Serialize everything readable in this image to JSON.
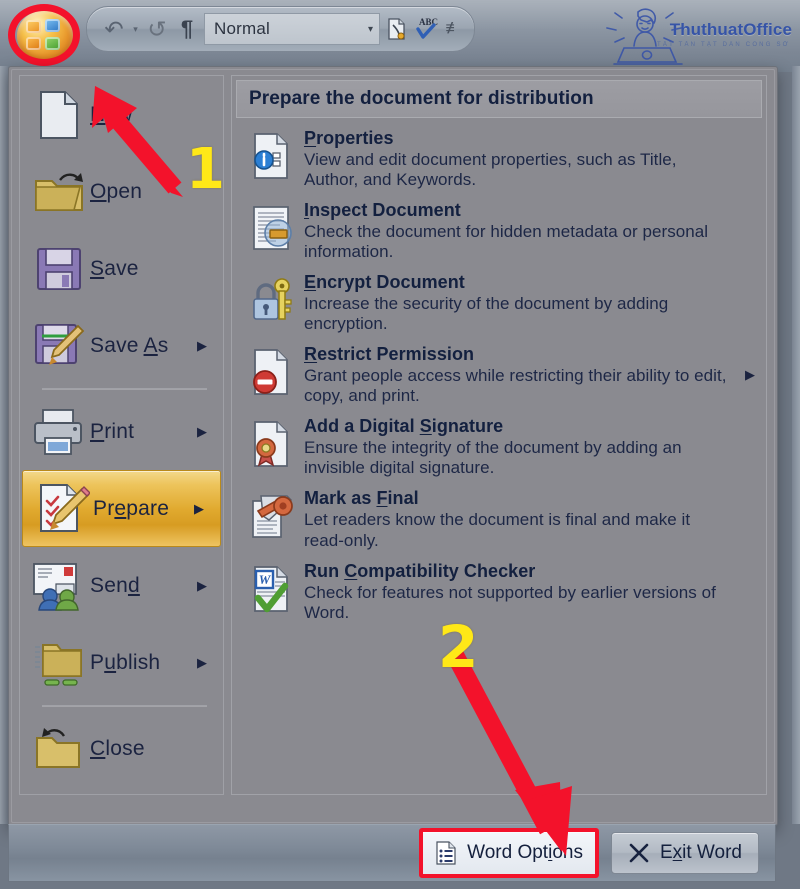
{
  "window": {
    "quick_access": {
      "undo_label": "Undo",
      "undo_dropdown": "▾",
      "redo_label": "Redo",
      "pilcrow_glyph": "¶",
      "style_value": "Normal",
      "style_caret": "▾",
      "print_preview_label": "Print Preview",
      "spelling_label": "Spelling & Grammar",
      "customize_glyph": "⩸"
    },
    "office_button_label": "Office Button",
    "watermark": {
      "brand": "ThuthuatOffice",
      "tagline": "TẤT TẦN TẬT DÂN CÔNG SỞ"
    }
  },
  "left_menu": {
    "items": [
      {
        "label": "New",
        "accel_prefix": "",
        "accel": "N",
        "accel_suffix": "ew",
        "icon": "new-document-icon",
        "has_submenu": false,
        "selected": false,
        "separator_after": false
      },
      {
        "label": "Open",
        "accel_prefix": "",
        "accel": "O",
        "accel_suffix": "pen",
        "icon": "open-folder-icon",
        "has_submenu": false,
        "selected": false,
        "separator_after": false
      },
      {
        "label": "Save",
        "accel_prefix": "",
        "accel": "S",
        "accel_suffix": "ave",
        "icon": "floppy-disk-icon",
        "has_submenu": false,
        "selected": false,
        "separator_after": false
      },
      {
        "label": "Save As",
        "accel_prefix": "Save ",
        "accel": "A",
        "accel_suffix": "s",
        "icon": "save-as-icon",
        "has_submenu": true,
        "selected": false,
        "separator_after": true
      },
      {
        "label": "Print",
        "accel_prefix": "",
        "accel": "P",
        "accel_suffix": "rint",
        "icon": "printer-icon",
        "has_submenu": true,
        "selected": false,
        "separator_after": false
      },
      {
        "label": "Prepare",
        "accel_prefix": "Pr",
        "accel": "e",
        "accel_suffix": "pare",
        "icon": "prepare-pencil-icon",
        "has_submenu": true,
        "selected": true,
        "separator_after": false
      },
      {
        "label": "Send",
        "accel_prefix": "Sen",
        "accel": "d",
        "accel_suffix": "",
        "icon": "send-envelope-icon",
        "has_submenu": true,
        "selected": false,
        "separator_after": false
      },
      {
        "label": "Publish",
        "accel_prefix": "P",
        "accel": "u",
        "accel_suffix": "blish",
        "icon": "publish-server-icon",
        "has_submenu": true,
        "selected": false,
        "separator_after": true
      },
      {
        "label": "Close",
        "accel_prefix": "",
        "accel": "C",
        "accel_suffix": "lose",
        "icon": "close-folder-icon",
        "has_submenu": false,
        "selected": false,
        "separator_after": false
      }
    ],
    "submenu_arrow": "▶"
  },
  "right_pane": {
    "title": "Prepare the document for distribution",
    "submenu_arrow": "▶",
    "items": [
      {
        "heading": "Properties",
        "accel_prefix": "",
        "accel": "P",
        "accel_suffix": "roperties",
        "description": "View and edit document properties, such as Title, Author, and Keywords.",
        "icon": "document-properties-icon",
        "has_submenu": false
      },
      {
        "heading": "Inspect Document",
        "accel_prefix": "",
        "accel": "I",
        "accel_suffix": "nspect Document",
        "description": "Check the document for hidden metadata or personal information.",
        "icon": "inspect-document-icon",
        "has_submenu": false
      },
      {
        "heading": "Encrypt Document",
        "accel_prefix": "",
        "accel": "E",
        "accel_suffix": "ncrypt Document",
        "description": "Increase the security of the document by adding encryption.",
        "icon": "encrypt-lock-key-icon",
        "has_submenu": false
      },
      {
        "heading": "Restrict Permission",
        "accel_prefix": "",
        "accel": "R",
        "accel_suffix": "estrict Permission",
        "description": "Grant people access while restricting their ability to edit, copy, and print.",
        "icon": "restrict-permission-icon",
        "has_submenu": true
      },
      {
        "heading": "Add a Digital Signature",
        "accel_prefix": "Add a Digital ",
        "accel": "S",
        "accel_suffix": "ignature",
        "description": "Ensure the integrity of the document by adding an invisible digital signature.",
        "icon": "digital-signature-icon",
        "has_submenu": false
      },
      {
        "heading": "Mark as Final",
        "accel_prefix": "Mark as ",
        "accel": "F",
        "accel_suffix": "inal",
        "description": "Let readers know the document is final and make it read-only.",
        "icon": "mark-as-final-icon",
        "has_submenu": false
      },
      {
        "heading": "Run Compatibility Checker",
        "accel_prefix": "Run ",
        "accel": "C",
        "accel_suffix": "ompatibility Checker",
        "description": "Check for features not supported by earlier versions of Word.",
        "icon": "compatibility-checker-icon",
        "has_submenu": false
      }
    ]
  },
  "bottom_bar": {
    "word_options_label": "Word Options",
    "word_options_accel_prefix": "Word Opt",
    "word_options_accel": "i",
    "word_options_accel_suffix": "ons",
    "exit_prefix": "E",
    "exit_accel": "x",
    "exit_suffix": "it Word",
    "exit_label": "Exit Word",
    "close_glyph": "✕"
  },
  "annotations": {
    "step_one": "1",
    "step_two": "2",
    "highlight_color": "#f3122b",
    "number_color": "#ffe817"
  }
}
